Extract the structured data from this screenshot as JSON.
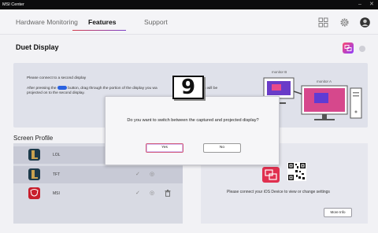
{
  "app": {
    "title": "MSI Center"
  },
  "nav": {
    "tabs": [
      {
        "label": "Hardware Monitoring"
      },
      {
        "label": "Features"
      },
      {
        "label": "Support"
      }
    ],
    "icons": [
      "grid-icon",
      "gear-icon",
      "avatar"
    ]
  },
  "duet": {
    "title": "Duet Display",
    "instructions": {
      "line1": "Please connect to a second display",
      "line2_start": "After pressing the",
      "line2_mid": "button, drag through the portion of the display you wa",
      "line2_end": "the selected portion will be",
      "line3": "projected on to the second display."
    },
    "monitor_b": "monitor B",
    "monitor_a": "monitor A"
  },
  "screen_profile": {
    "title": "Screen Profile",
    "items": [
      {
        "name": "LOL"
      },
      {
        "name": "TFT"
      },
      {
        "name": "MSI"
      }
    ]
  },
  "ios": {
    "message": "Please connect your iOS Device to view or change settings",
    "more_label": "More Info"
  },
  "dialog": {
    "question": "Do you want to switch between the captured and projected display?",
    "yes_label": "Yes",
    "no_label": "No"
  },
  "step_badge": "9",
  "colors": {
    "accent_red": "#d23b4b",
    "accent_purple": "#7a3fc8",
    "button_blue": "#2a62e0"
  }
}
